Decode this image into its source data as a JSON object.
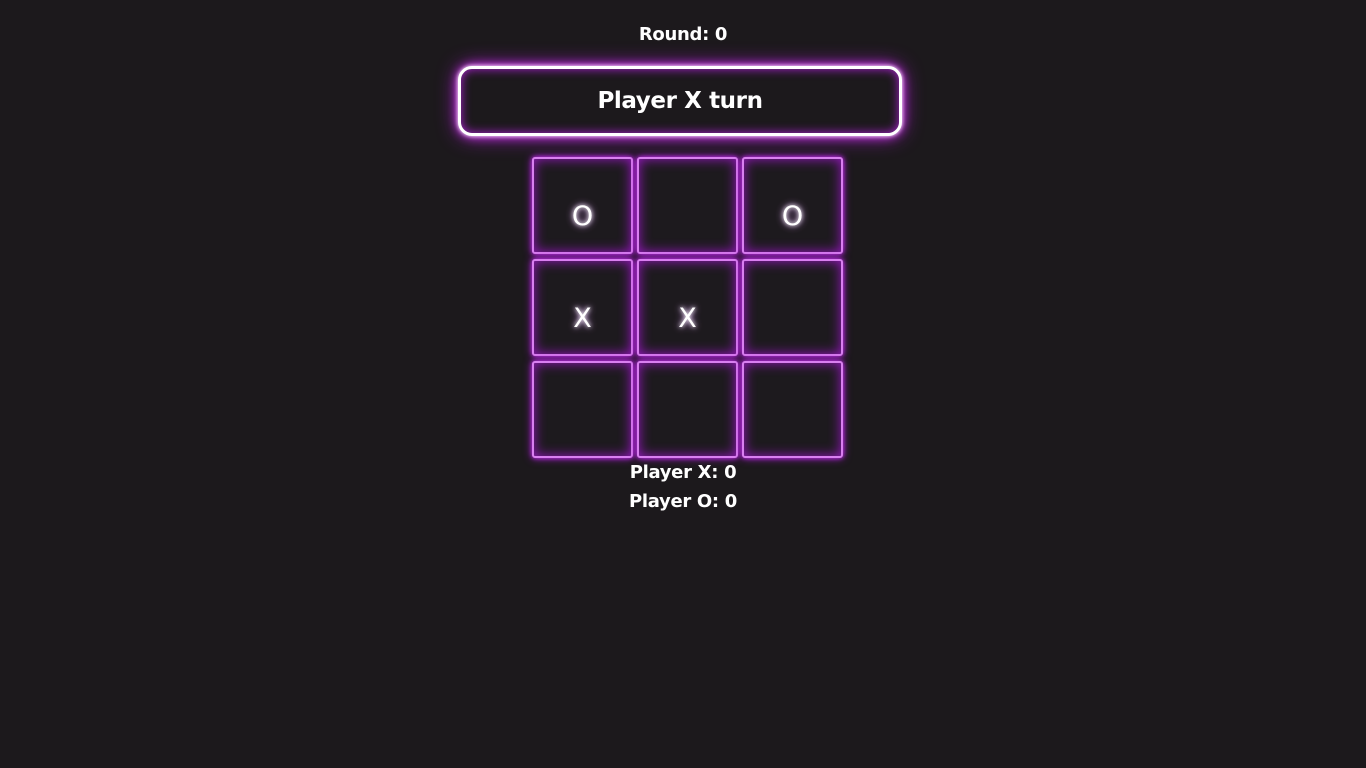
{
  "header": {
    "round_label": "Round: 0"
  },
  "status": {
    "turn_text": "Player X turn"
  },
  "board": {
    "cells": [
      "O",
      "",
      "O",
      "X",
      "X",
      "",
      "",
      "",
      ""
    ]
  },
  "scores": {
    "player_x": "Player X: 0",
    "player_o": "Player O: 0"
  },
  "colors": {
    "background": "#1c191c",
    "neon_accent": "#c030e8",
    "cell_border": "#d97ff0",
    "text": "#ffffff"
  }
}
